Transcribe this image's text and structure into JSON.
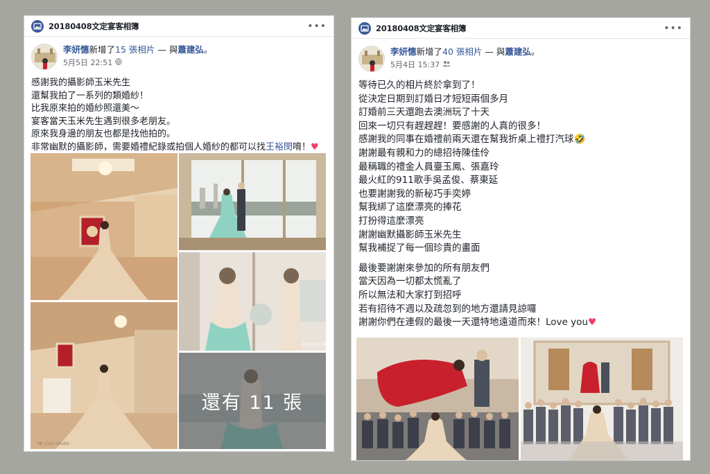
{
  "posts": [
    {
      "album_title": "20180408文定宴客相簿",
      "author": "李妍憓",
      "action_text": "新增了",
      "photo_count_text": "15 張相片",
      "with_text": " — 與",
      "tagged": "蕭建弘",
      "period": "。",
      "date": "5月5日 22:51",
      "privacy_icon": "public-globe-icon",
      "lines": [
        "感謝我的攝影師玉米先生",
        "還幫我拍了一系列的類婚紗！",
        "比我原來拍的婚紗照還美～",
        "宴客當天玉米先生遇到很多老朋友。",
        "原來我身邊的朋友也都是找他拍的。"
      ],
      "last_line_prefix": "非常幽默的攝影師，需要婚禮紀錄或拍個人婚紗的都可以找",
      "last_line_link": "王裕閔",
      "last_line_suffix": "唷！",
      "heart": "♥",
      "more_photos_text": "還有 11 張",
      "watermark": "Mr. Corn Studio"
    },
    {
      "album_title": "20180408文定宴客相簿",
      "author": "李妍憓",
      "action_text": "新增了",
      "photo_count_text": "40 張相片",
      "with_text": " — 與",
      "tagged": "蕭建弘",
      "period": "。",
      "date": "5月4日 15:37",
      "privacy_icon": "friends-icon",
      "lines": [
        "等待已久的相片終於拿到了！",
        "從決定日期到訂婚日才短短兩個多月",
        "訂婚前三天還跑去澳洲玩了十天",
        "回來一切只有趕趕趕！要感謝的人真的很多！",
        "感謝我的同事在婚禮前兩天還在幫我折桌上禮打汽球",
        "謝謝最有親和力的總招待陳佳伶",
        "最稱職的禮金人員臺玉鳳、張嘉玲",
        "最火紅的911歌手吳孟俊、蔡東延",
        "也要謝謝我的新秘巧手奕婷",
        "幫我綁了這麼漂亮的捧花",
        "打扮得這麼漂亮",
        "謝謝幽默攝影師玉米先生",
        "幫我補捉了每一個珍貴的畫面"
      ],
      "lines2": [
        "最後要謝謝來參加的所有朋友們",
        "當天因為一切都太慌亂了",
        "所以無法和大家打到招呼",
        "若有招待不週以及疏忽到的地方還請見諒囉"
      ],
      "last_line": "謝謝你們在連假的最後一天還特地遠道而來！Love you",
      "emoji_laugh": "🤣",
      "heart": "♥"
    }
  ],
  "colors": {
    "page_bg": "#a6a6a0",
    "link_blue": "#365899",
    "heart_pink": "#f03c66",
    "dress_mint": "#8fd2c2",
    "dress_red": "#c8202c"
  }
}
